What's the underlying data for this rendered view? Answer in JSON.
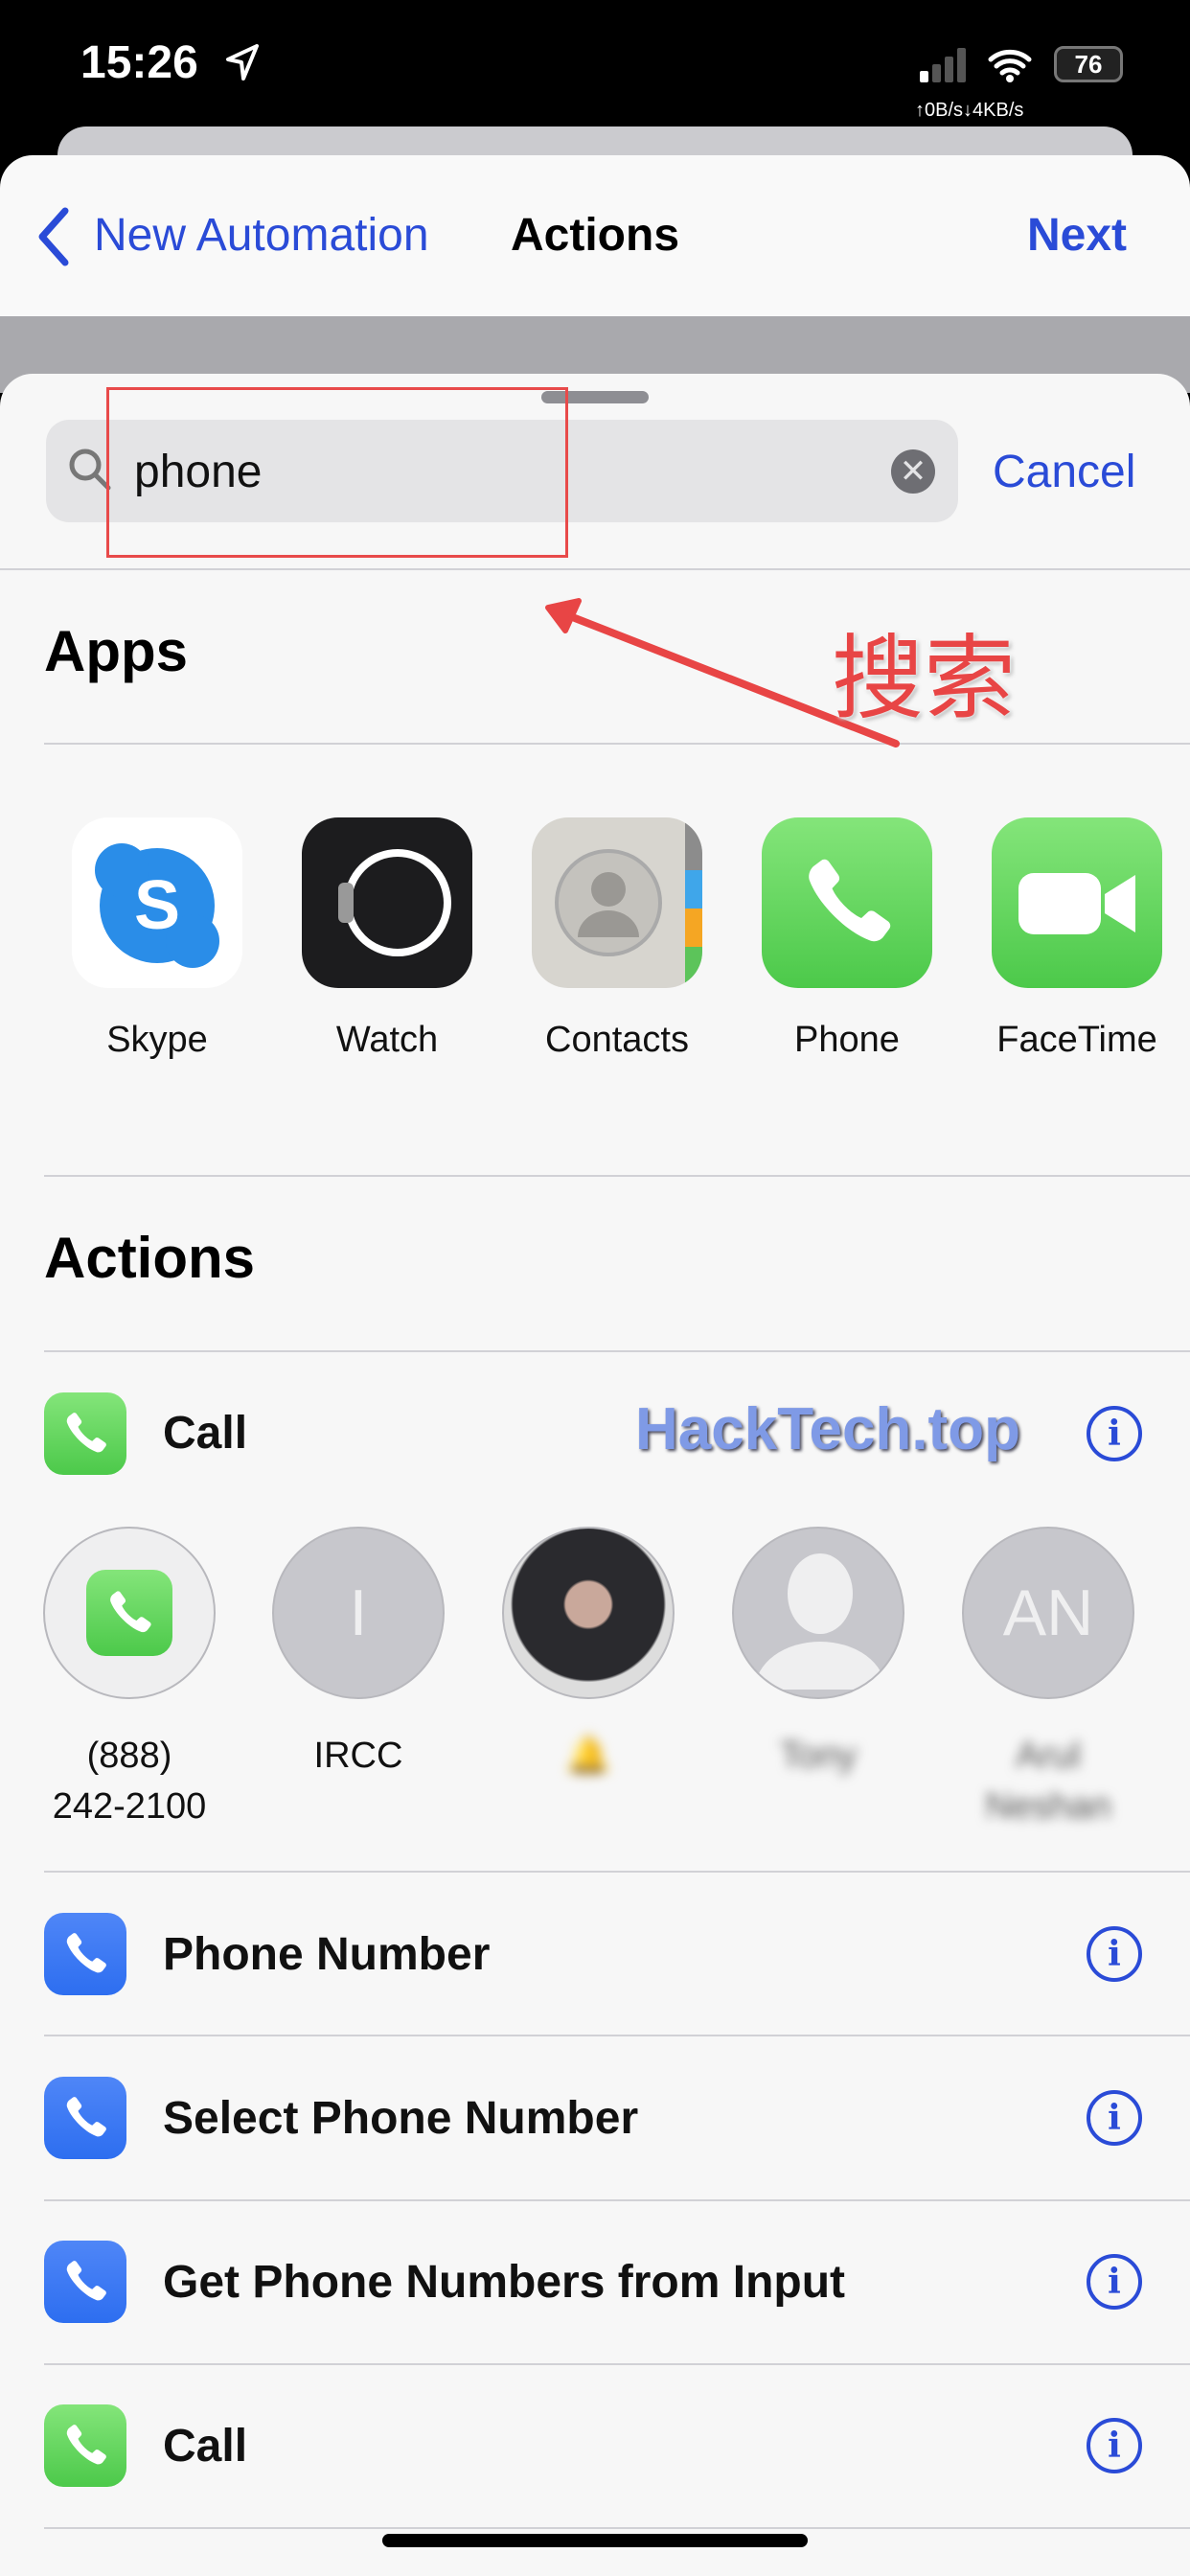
{
  "status": {
    "time": "15:26",
    "battery": "76",
    "netspeed": "↑0B/s↓4KB/s"
  },
  "nav": {
    "back_label": "New Automation",
    "title": "Actions",
    "next_label": "Next"
  },
  "search": {
    "value": "phone",
    "cancel_label": "Cancel"
  },
  "apps": {
    "heading": "Apps",
    "items": [
      {
        "label": "Skype"
      },
      {
        "label": "Watch"
      },
      {
        "label": "Contacts"
      },
      {
        "label": "Phone"
      },
      {
        "label": "FaceTime"
      }
    ]
  },
  "actions": {
    "heading": "Actions",
    "call_label": "Call",
    "contacts": [
      {
        "line1": "(888)",
        "line2": "242-2100"
      },
      {
        "initial": "I",
        "line1": "IRCC"
      },
      {
        "line1": "🔔"
      },
      {
        "line1": "Tony"
      },
      {
        "initial": "AN",
        "line1": "Arul",
        "line2": "Neshan"
      }
    ],
    "rows": [
      {
        "label": "Phone Number",
        "icon": "phone-icon-blue"
      },
      {
        "label": "Select Phone Number",
        "icon": "phone-icon-blue"
      },
      {
        "label": "Get Phone Numbers from Input",
        "icon": "phone-icon-blue"
      },
      {
        "label": "Call",
        "icon": "phone-icon-green"
      }
    ]
  },
  "watermark": "HackTech.top",
  "annotation": {
    "text": "搜索",
    "color": "#e84545"
  },
  "colors": {
    "accent": "#2a4bd7",
    "annotation": "#e84545"
  }
}
